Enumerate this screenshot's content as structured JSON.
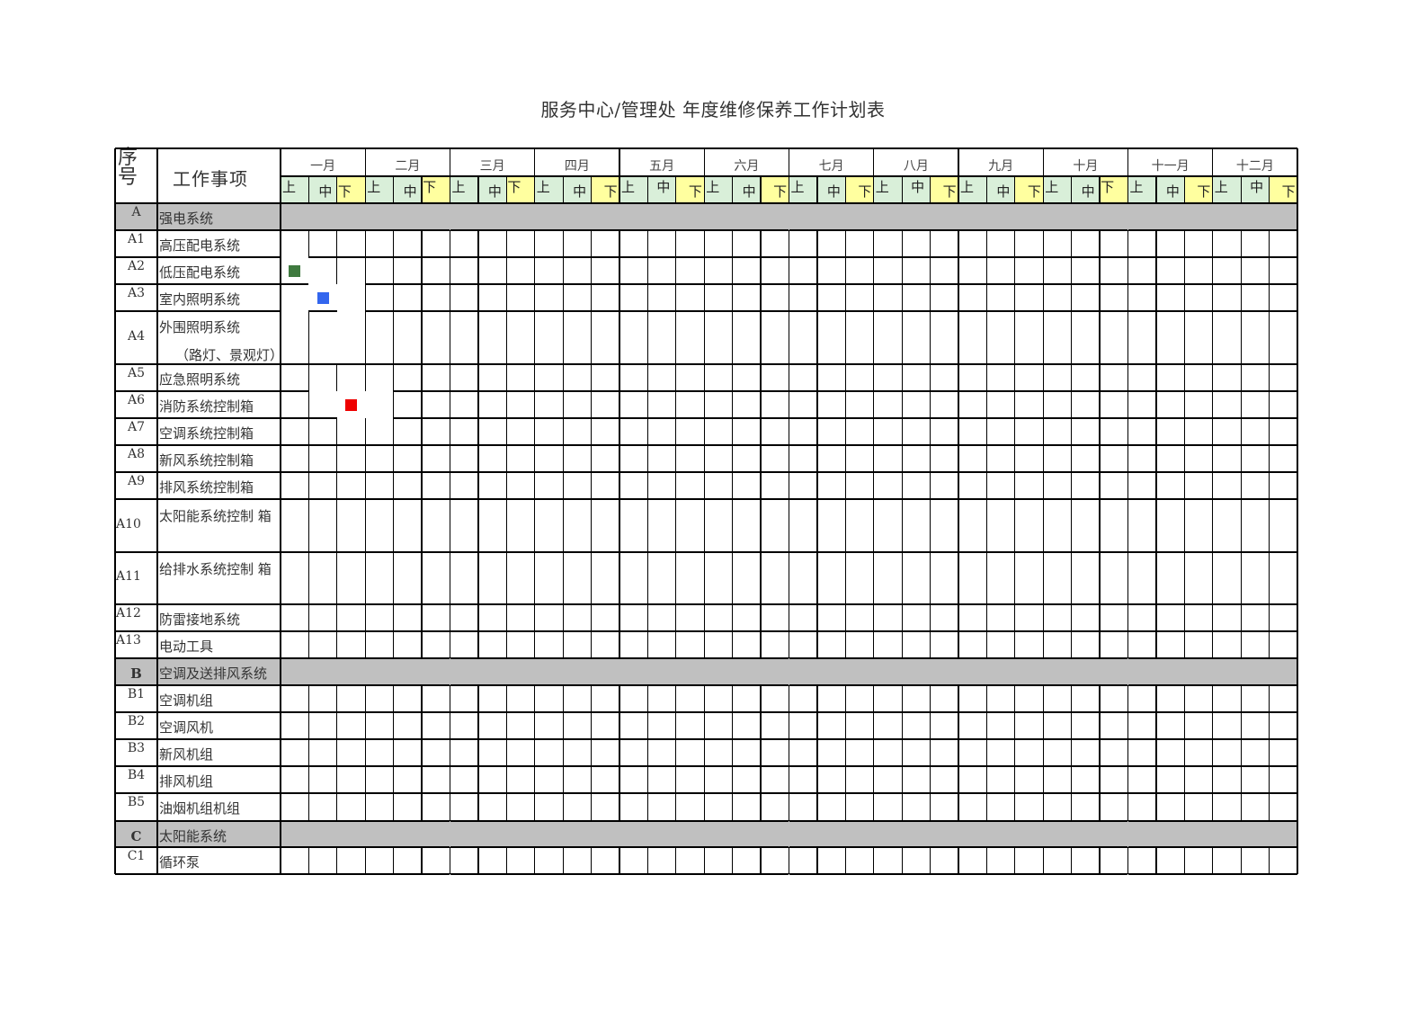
{
  "title": "服务中心/管理处 年度维修保养工作计划表",
  "header": {
    "seq_label": "序号",
    "seq_line1": "序",
    "seq_line2": "号",
    "item_label": "工作事项",
    "months": [
      "一月",
      "二月",
      "三月",
      "四月",
      "五月",
      "六月",
      "七月",
      "八月",
      "九月",
      "十月",
      "十一月",
      "十二月"
    ],
    "periods": [
      "上",
      "中",
      "下"
    ]
  },
  "colors": {
    "period_up": "#d9efd9",
    "period_mid": "#d9efd9",
    "period_down": "#ffff9f",
    "group_bg": "#c0c0c0",
    "grid_line": "#000000"
  },
  "rows": [
    {
      "type": "group",
      "id": "A",
      "name": "强电系统"
    },
    {
      "type": "item",
      "id": "A1",
      "name": "高压配电系统"
    },
    {
      "type": "item",
      "id": "A2",
      "name": "低压配电系统"
    },
    {
      "type": "item",
      "id": "A3",
      "name": "室内照明系统"
    },
    {
      "type": "item",
      "id": "A4",
      "name": "外围照明系统",
      "name2": "（路灯、景观灯）"
    },
    {
      "type": "item",
      "id": "A5",
      "name": "应急照明系统"
    },
    {
      "type": "item",
      "id": "A6",
      "name": "消防系统控制箱"
    },
    {
      "type": "item",
      "id": "A7",
      "name": "空调系统控制箱"
    },
    {
      "type": "item",
      "id": "A8",
      "name": "新风系统控制箱"
    },
    {
      "type": "item",
      "id": "A9",
      "name": "排风系统控制箱"
    },
    {
      "type": "item",
      "id": "A10",
      "name": "太阳能系统控制 箱"
    },
    {
      "type": "item",
      "id": "A11",
      "name": "给排水系统控制 箱"
    },
    {
      "type": "item",
      "id": "A12",
      "name": "防雷接地系统"
    },
    {
      "type": "item",
      "id": "A13",
      "name": "电动工具"
    },
    {
      "type": "group",
      "id": "B",
      "name": "空调及送排风系统"
    },
    {
      "type": "item",
      "id": "B1",
      "name": "空调机组"
    },
    {
      "type": "item",
      "id": "B2",
      "name": "空调风机"
    },
    {
      "type": "item",
      "id": "B3",
      "name": "新风机组"
    },
    {
      "type": "item",
      "id": "B4",
      "name": "排风机组"
    },
    {
      "type": "item",
      "id": "B5",
      "name": "油烟机组机组"
    },
    {
      "type": "group",
      "id": "C",
      "name": "太阳能系统"
    },
    {
      "type": "item",
      "id": "C1",
      "name": "循环泵"
    }
  ],
  "markers": [
    {
      "row": "A2",
      "month": "一月",
      "period": "上",
      "color": "#3f7a3f",
      "label": "green-marker"
    },
    {
      "row": "A3",
      "month": "一月",
      "period": "中",
      "color": "#3366ee",
      "label": "blue-marker"
    },
    {
      "row": "A6",
      "month": "一月",
      "period": "下",
      "color": "#ee0000",
      "label": "red-marker"
    }
  ]
}
